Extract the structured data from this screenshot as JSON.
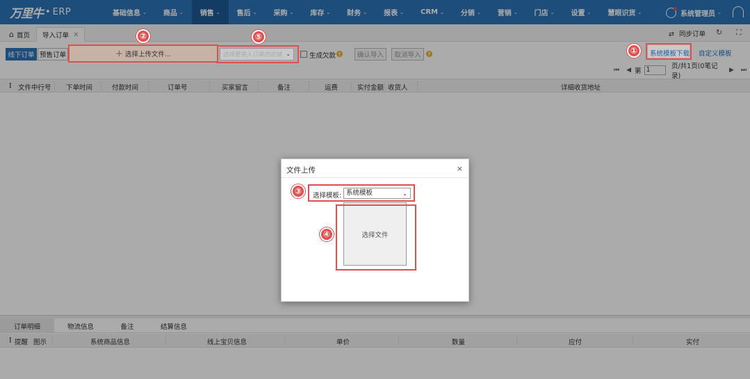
{
  "brand": {
    "logo_text": "万里牛",
    "dot": "•",
    "suffix": "ERP"
  },
  "nav": {
    "items": [
      {
        "label": "基础信息"
      },
      {
        "label": "商品"
      },
      {
        "label": "销售"
      },
      {
        "label": "售后"
      },
      {
        "label": "采购"
      },
      {
        "label": "库存"
      },
      {
        "label": "财务"
      },
      {
        "label": "报表"
      },
      {
        "label": "CRM"
      },
      {
        "label": "分销"
      },
      {
        "label": "营销"
      },
      {
        "label": "门店"
      },
      {
        "label": "设置"
      },
      {
        "label": "慧眼识货"
      }
    ],
    "active_index": 2,
    "caret": "⌄"
  },
  "user": {
    "name": "系统管理员",
    "caret": "⌄"
  },
  "tabs": {
    "home": {
      "icon": "⌂",
      "label": "首页"
    },
    "import": {
      "label": "导入订单",
      "close": "✕"
    },
    "sync_label": "同步订单",
    "sync_icon": "⇄",
    "refresh_icon": "↻",
    "fullscreen_icon": "⛶"
  },
  "toolbar": {
    "offline_label": "线下订单",
    "presale_label": "预售订单",
    "upload_plus": "+",
    "upload_label": "选择上传文件...",
    "store_placeholder": "选择要导入订单的店铺",
    "store_caret": "⌄",
    "gen_debt_label": "生成欠款",
    "q": "?",
    "confirm_label": "确认导入",
    "cancel_label": "取消导入",
    "download_template": "系统模板下载",
    "custom_template": "自定义模板"
  },
  "pager": {
    "first": "⏮",
    "prev": "◀",
    "prefix": "第",
    "page": "1",
    "suffix": "页/共1页(0笔记录)",
    "next": "▶",
    "last": "⏭"
  },
  "grid": {
    "menu_icon": "⋮",
    "columns": [
      "文件中行号",
      "下单时间",
      "付款时间",
      "订单号",
      "买家留言",
      "备注",
      "运费",
      "实付金额",
      "收货人",
      "详细收货地址"
    ]
  },
  "bottom": {
    "tabs": [
      "订单明细",
      "物流信息",
      "备注",
      "结算信息"
    ],
    "menu_icon": "⋮",
    "columns": [
      "提醒",
      "图示",
      "系统商品信息",
      "线上宝贝信息",
      "单价",
      "数量",
      "应付",
      "实付"
    ]
  },
  "modal": {
    "title": "文件上传",
    "close": "×",
    "template_label": "选择模板:",
    "template_value": "系统模板",
    "template_caret": "⌄",
    "file_label": "选择文件"
  },
  "badges": [
    "①",
    "②",
    "③",
    "④",
    "⑤"
  ],
  "colors": {
    "nav_bg": "#2a74b8",
    "annotation": "#e05050"
  }
}
